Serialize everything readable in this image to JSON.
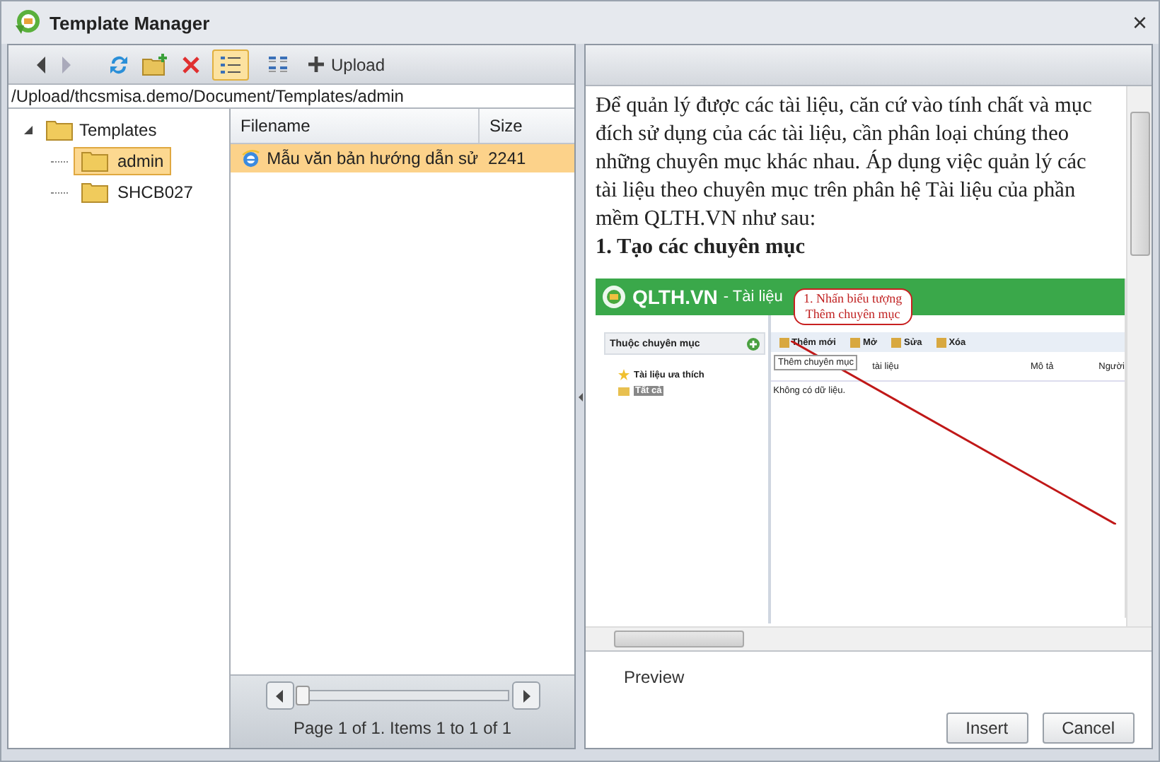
{
  "window": {
    "title": "Template Manager",
    "close_glyph": "×"
  },
  "toolbar": {
    "back": {
      "disabled": false
    },
    "forward": {
      "disabled": true
    },
    "view_modes": [
      {
        "kind": "details",
        "selected": true
      },
      {
        "kind": "thumbnails",
        "selected": false
      }
    ],
    "upload_label": "Upload"
  },
  "path": "/Upload/thcsmisa.demo/Document/Templates/admin",
  "tree": {
    "label": "Templates",
    "expanded": true,
    "children": [
      {
        "label": "admin",
        "selected": true
      },
      {
        "label": "SHCB027",
        "selected": false
      }
    ]
  },
  "file_list": {
    "columns": [
      "Filename",
      "Size"
    ],
    "rows": [
      {
        "filename": "Mẫu văn bản hướng dẫn sử",
        "size": "2241",
        "selected": true
      }
    ]
  },
  "pager": {
    "text": "Page 1 of 1. Items 1 to 1 of 1",
    "level": 0
  },
  "preview": {
    "paragraph": "Để quản lý được các tài liệu, căn cứ vào tính chất và mục đích sử dụng của các tài liệu, cần phân loại chúng theo những chuyên mục khác nhau. Áp dụng việc quản lý các tài liệu theo chuyên mục trên phân hệ Tài liệu của phần mềm QLTH.VN như sau:",
    "heading": "1. Tạo các chuyên mục",
    "embedded": {
      "app_title": "QLTH.VN",
      "module": "- Tài liệu",
      "panel_title": "Thuộc chuyên mục",
      "tree": [
        "Tài liệu ưa thích",
        "Tất cả"
      ],
      "actions": [
        "Thêm mới",
        "Mở",
        "Sửa",
        "Xóa"
      ],
      "columns": [
        "tài liệu",
        "Mô tả",
        "Người"
      ],
      "empty": "Không có dữ liệu.",
      "tooltip": "Thêm chuyên mục",
      "callout": [
        "1. Nhấn biểu tượng",
        "Thêm chuyên mục"
      ]
    },
    "label": "Preview"
  },
  "buttons": [
    "Insert",
    "Cancel"
  ]
}
